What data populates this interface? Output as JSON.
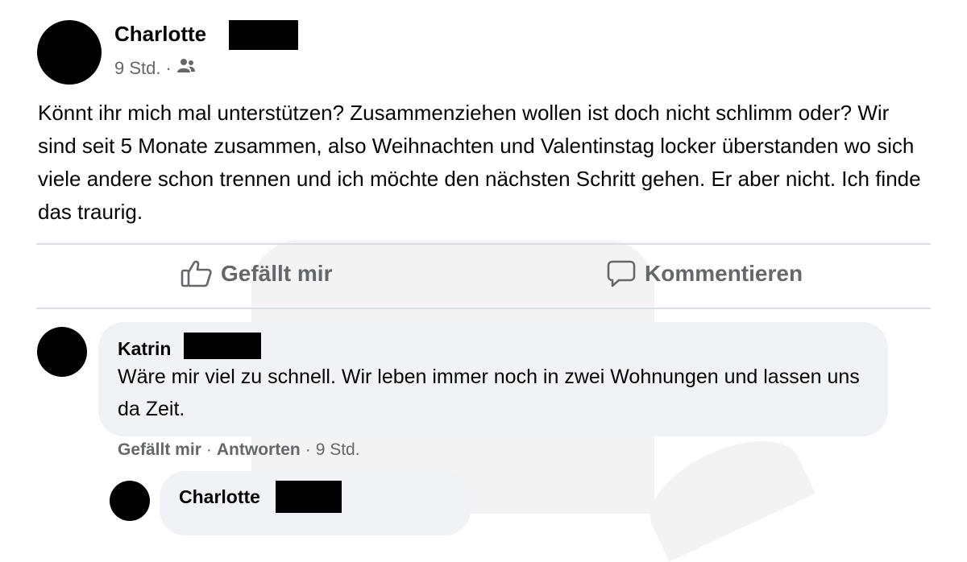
{
  "post": {
    "author": "Charlotte",
    "time": "9 Std.",
    "separator": "·",
    "audience_icon": "friends-icon",
    "text": "Könnt ihr mich mal unterstützen? Zusammenziehen wollen ist doch nicht schlimm oder? Wir sind seit 5 Monate zusammen, also Weihnachten und Valentinstag locker überstanden wo sich viele andere schon trennen und ich möchte den nächsten Schritt gehen. Er aber nicht. Ich finde das traurig."
  },
  "actions": {
    "like_label": "Gefällt mir",
    "like_icon": "thumbs-up-icon",
    "comment_label": "Kommentieren",
    "comment_icon": "speech-bubble-icon"
  },
  "comments": [
    {
      "author": "Katrin",
      "text": "Wäre mir viel zu schnell. Wir leben immer noch in zwei Wohnungen und lassen uns da Zeit.",
      "like_label": "Gefällt mir",
      "reply_label": "Antworten",
      "time": "9 Std.",
      "separator": "·"
    },
    {
      "author": "Charlotte"
    }
  ],
  "colors": {
    "text": "#050505",
    "secondary": "#65676b",
    "bubble": "#f0f2f5",
    "divider": "#dadde1"
  }
}
